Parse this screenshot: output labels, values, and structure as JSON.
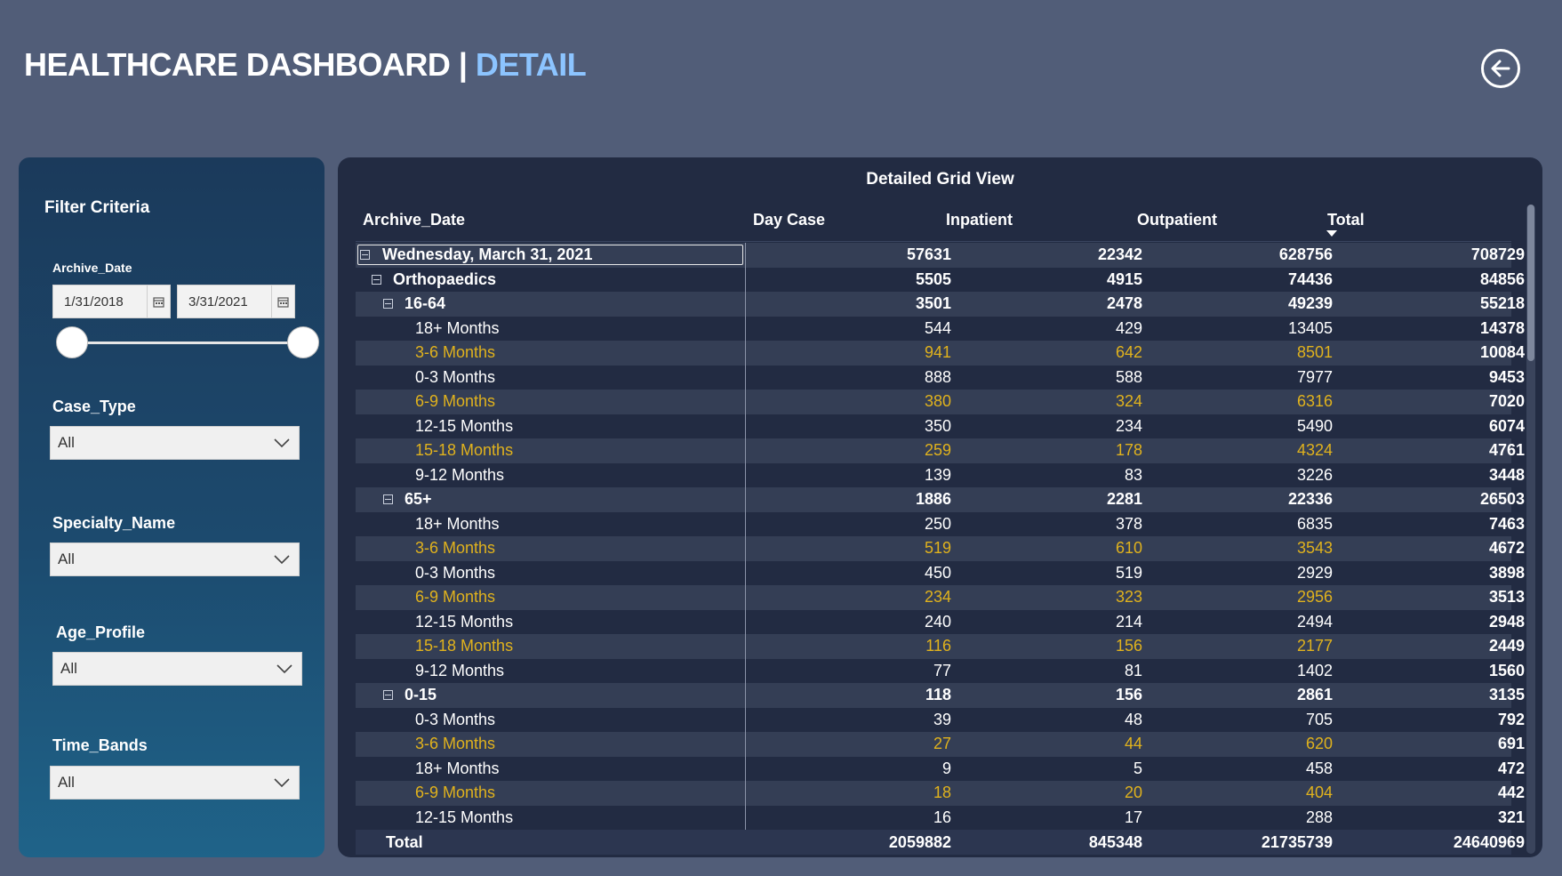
{
  "header": {
    "title_main": "HEALTHCARE DASHBOARD",
    "title_sep": " | ",
    "title_accent": "DETAIL"
  },
  "filters": {
    "title": "Filter Criteria",
    "archive_date": {
      "label": "Archive_Date",
      "start": "1/31/2018",
      "end": "3/31/2021",
      "range": [
        0,
        1
      ]
    },
    "case_type": {
      "label": "Case_Type",
      "value": "All"
    },
    "specialty_name": {
      "label": "Specialty_Name",
      "value": "All"
    },
    "age_profile": {
      "label": "Age_Profile",
      "value": "All"
    },
    "time_bands": {
      "label": "Time_Bands",
      "value": "All"
    }
  },
  "grid": {
    "title": "Detailed Grid View",
    "columns": [
      "Archive_Date",
      "Day Case",
      "Inpatient",
      "Outpatient",
      "Total"
    ],
    "sorted_column": "Total",
    "rows": [
      {
        "level": 0,
        "label": "Wednesday, March 31, 2021",
        "values": [
          "57631",
          "22342",
          "628756",
          "708729"
        ],
        "group": true,
        "selected": true
      },
      {
        "level": 1,
        "label": "Orthopaedics",
        "values": [
          "5505",
          "4915",
          "74436",
          "84856"
        ],
        "group": true
      },
      {
        "level": 2,
        "label": "16-64",
        "values": [
          "3501",
          "2478",
          "49239",
          "55218"
        ],
        "group": true
      },
      {
        "level": 3,
        "label": "18+ Months",
        "values": [
          "544",
          "429",
          "13405",
          "14378"
        ]
      },
      {
        "level": 3,
        "label": "3-6 Months",
        "values": [
          "941",
          "642",
          "8501",
          "10084"
        ],
        "highlight": true
      },
      {
        "level": 3,
        "label": "0-3 Months",
        "values": [
          "888",
          "588",
          "7977",
          "9453"
        ]
      },
      {
        "level": 3,
        "label": "6-9 Months",
        "values": [
          "380",
          "324",
          "6316",
          "7020"
        ],
        "highlight": true
      },
      {
        "level": 3,
        "label": "12-15 Months",
        "values": [
          "350",
          "234",
          "5490",
          "6074"
        ]
      },
      {
        "level": 3,
        "label": "15-18 Months",
        "values": [
          "259",
          "178",
          "4324",
          "4761"
        ],
        "highlight": true
      },
      {
        "level": 3,
        "label": "9-12 Months",
        "values": [
          "139",
          "83",
          "3226",
          "3448"
        ]
      },
      {
        "level": 2,
        "label": "65+",
        "values": [
          "1886",
          "2281",
          "22336",
          "26503"
        ],
        "group": true
      },
      {
        "level": 3,
        "label": "18+ Months",
        "values": [
          "250",
          "378",
          "6835",
          "7463"
        ]
      },
      {
        "level": 3,
        "label": "3-6 Months",
        "values": [
          "519",
          "610",
          "3543",
          "4672"
        ],
        "highlight": true
      },
      {
        "level": 3,
        "label": "0-3 Months",
        "values": [
          "450",
          "519",
          "2929",
          "3898"
        ]
      },
      {
        "level": 3,
        "label": "6-9 Months",
        "values": [
          "234",
          "323",
          "2956",
          "3513"
        ],
        "highlight": true
      },
      {
        "level": 3,
        "label": "12-15 Months",
        "values": [
          "240",
          "214",
          "2494",
          "2948"
        ]
      },
      {
        "level": 3,
        "label": "15-18 Months",
        "values": [
          "116",
          "156",
          "2177",
          "2449"
        ],
        "highlight": true
      },
      {
        "level": 3,
        "label": "9-12 Months",
        "values": [
          "77",
          "81",
          "1402",
          "1560"
        ]
      },
      {
        "level": 2,
        "label": "0-15",
        "values": [
          "118",
          "156",
          "2861",
          "3135"
        ],
        "group": true
      },
      {
        "level": 3,
        "label": "0-3 Months",
        "values": [
          "39",
          "48",
          "705",
          "792"
        ]
      },
      {
        "level": 3,
        "label": "3-6 Months",
        "values": [
          "27",
          "44",
          "620",
          "691"
        ],
        "highlight": true
      },
      {
        "level": 3,
        "label": "18+ Months",
        "values": [
          "9",
          "5",
          "458",
          "472"
        ]
      },
      {
        "level": 3,
        "label": "6-9 Months",
        "values": [
          "18",
          "20",
          "404",
          "442"
        ],
        "highlight": true
      },
      {
        "level": 3,
        "label": "12-15 Months",
        "values": [
          "16",
          "17",
          "288",
          "321"
        ]
      }
    ],
    "total": {
      "label": "Total",
      "values": [
        "2059882",
        "845348",
        "21735739",
        "24640969"
      ]
    }
  },
  "colors": {
    "background": "#515d78",
    "accent": "#8cc4ff",
    "highlight_text": "#e0b21d",
    "panel": "#222b42"
  },
  "icons": {
    "back": "arrow-left-circle-icon",
    "calendar": "calendar-icon",
    "dropdown": "chevron-down-icon",
    "expand": "minus-square-icon"
  }
}
